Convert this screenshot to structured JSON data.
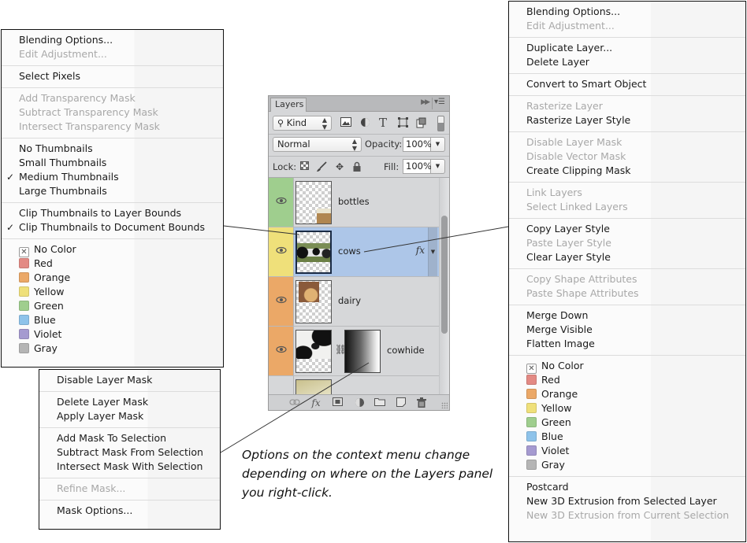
{
  "left_menu": {
    "groups": [
      [
        {
          "label": "Blending Options...",
          "enabled": true
        },
        {
          "label": "Edit Adjustment...",
          "enabled": false
        }
      ],
      [
        {
          "label": "Select Pixels",
          "enabled": true
        }
      ],
      [
        {
          "label": "Add Transparency Mask",
          "enabled": false
        },
        {
          "label": "Subtract Transparency Mask",
          "enabled": false
        },
        {
          "label": "Intersect Transparency Mask",
          "enabled": false
        }
      ],
      [
        {
          "label": "No Thumbnails",
          "enabled": true,
          "checked": false
        },
        {
          "label": "Small Thumbnails",
          "enabled": true,
          "checked": false
        },
        {
          "label": "Medium Thumbnails",
          "enabled": true,
          "checked": true
        },
        {
          "label": "Large Thumbnails",
          "enabled": true,
          "checked": false
        }
      ],
      [
        {
          "label": "Clip Thumbnails to Layer Bounds",
          "enabled": true,
          "checked": false
        },
        {
          "label": "Clip Thumbnails to Document Bounds",
          "enabled": true,
          "checked": true
        }
      ],
      [
        {
          "label": "No Color",
          "enabled": true,
          "swatch": "none"
        },
        {
          "label": "Red",
          "enabled": true,
          "swatch": "#e38a84"
        },
        {
          "label": "Orange",
          "enabled": true,
          "swatch": "#eba867"
        },
        {
          "label": "Yellow",
          "enabled": true,
          "swatch": "#efe07a"
        },
        {
          "label": "Green",
          "enabled": true,
          "swatch": "#9fce8e"
        },
        {
          "label": "Blue",
          "enabled": true,
          "swatch": "#8ec3ea"
        },
        {
          "label": "Violet",
          "enabled": true,
          "swatch": "#a59ad0"
        },
        {
          "label": "Gray",
          "enabled": true,
          "swatch": "#b5b5b5"
        }
      ]
    ]
  },
  "mask_menu": {
    "groups": [
      [
        {
          "label": "Disable Layer Mask",
          "enabled": true
        }
      ],
      [
        {
          "label": "Delete Layer Mask",
          "enabled": true
        },
        {
          "label": "Apply Layer Mask",
          "enabled": true
        }
      ],
      [
        {
          "label": "Add Mask To Selection",
          "enabled": true
        },
        {
          "label": "Subtract Mask From Selection",
          "enabled": true
        },
        {
          "label": "Intersect Mask With Selection",
          "enabled": true
        }
      ],
      [
        {
          "label": "Refine Mask...",
          "enabled": false
        }
      ],
      [
        {
          "label": "Mask Options...",
          "enabled": true
        }
      ]
    ]
  },
  "right_menu": {
    "groups": [
      [
        {
          "label": "Blending Options...",
          "enabled": true
        },
        {
          "label": "Edit Adjustment...",
          "enabled": false
        }
      ],
      [
        {
          "label": "Duplicate Layer...",
          "enabled": true
        },
        {
          "label": "Delete Layer",
          "enabled": true
        }
      ],
      [
        {
          "label": "Convert to Smart Object",
          "enabled": true
        }
      ],
      [
        {
          "label": "Rasterize Layer",
          "enabled": false
        },
        {
          "label": "Rasterize Layer Style",
          "enabled": true
        }
      ],
      [
        {
          "label": "Disable Layer Mask",
          "enabled": false
        },
        {
          "label": "Disable Vector Mask",
          "enabled": false
        },
        {
          "label": "Create Clipping Mask",
          "enabled": true
        }
      ],
      [
        {
          "label": "Link Layers",
          "enabled": false
        },
        {
          "label": "Select Linked Layers",
          "enabled": false
        }
      ],
      [
        {
          "label": "Copy Layer Style",
          "enabled": true
        },
        {
          "label": "Paste Layer Style",
          "enabled": false
        },
        {
          "label": "Clear Layer Style",
          "enabled": true
        }
      ],
      [
        {
          "label": "Copy Shape Attributes",
          "enabled": false
        },
        {
          "label": "Paste Shape Attributes",
          "enabled": false
        }
      ],
      [
        {
          "label": "Merge Down",
          "enabled": true
        },
        {
          "label": "Merge Visible",
          "enabled": true
        },
        {
          "label": "Flatten Image",
          "enabled": true
        }
      ],
      [
        {
          "label": "No Color",
          "enabled": true,
          "swatch": "none"
        },
        {
          "label": "Red",
          "enabled": true,
          "swatch": "#e38a84"
        },
        {
          "label": "Orange",
          "enabled": true,
          "swatch": "#eba867"
        },
        {
          "label": "Yellow",
          "enabled": true,
          "swatch": "#efe07a"
        },
        {
          "label": "Green",
          "enabled": true,
          "swatch": "#9fce8e"
        },
        {
          "label": "Blue",
          "enabled": true,
          "swatch": "#8ec3ea"
        },
        {
          "label": "Violet",
          "enabled": true,
          "swatch": "#a59ad0"
        },
        {
          "label": "Gray",
          "enabled": true,
          "swatch": "#b5b5b5"
        }
      ],
      [
        {
          "label": "Postcard",
          "enabled": true
        },
        {
          "label": "New 3D Extrusion from Selected Layer",
          "enabled": true
        },
        {
          "label": "New 3D Extrusion from Current Selection",
          "enabled": false
        }
      ]
    ]
  },
  "layers_panel": {
    "tab_label": "Layers",
    "filter_kind": "Kind",
    "blend_mode": "Normal",
    "opacity_label": "Opacity:",
    "opacity_value": "100%",
    "lock_label": "Lock:",
    "fill_label": "Fill:",
    "fill_value": "100%",
    "filter_icons": [
      "image-filter-icon",
      "adjustment-filter-icon",
      "type-filter-icon",
      "shape-filter-icon",
      "smart-object-filter-icon"
    ],
    "lock_icons": [
      "lock-transparent-icon",
      "lock-paint-icon",
      "lock-position-icon",
      "lock-all-icon"
    ],
    "footer_icons": [
      "link-icon",
      "fx-icon",
      "add-mask-icon",
      "adjustment-layer-icon",
      "new-group-icon",
      "new-layer-icon",
      "trash-icon"
    ],
    "layers": [
      {
        "name": "bottles",
        "label_color": "#9fce8e",
        "visible": true,
        "selected": false,
        "has_fx": false,
        "has_mask": false
      },
      {
        "name": "cows",
        "label_color": "#efe07a",
        "visible": true,
        "selected": true,
        "has_fx": true,
        "has_mask": false
      },
      {
        "name": "dairy",
        "label_color": "#eba867",
        "visible": true,
        "selected": false,
        "has_fx": false,
        "has_mask": false
      },
      {
        "name": "cowhide",
        "label_color": "#eba867",
        "visible": true,
        "selected": false,
        "has_fx": false,
        "has_mask": true
      },
      {
        "name": "",
        "label_color": "#d6d7d9",
        "visible": false,
        "selected": false,
        "has_fx": false,
        "has_mask": false
      }
    ],
    "fx_symbol": "fx"
  },
  "caption": "Options on the context menu change depending on where on the Layers panel you right-click."
}
